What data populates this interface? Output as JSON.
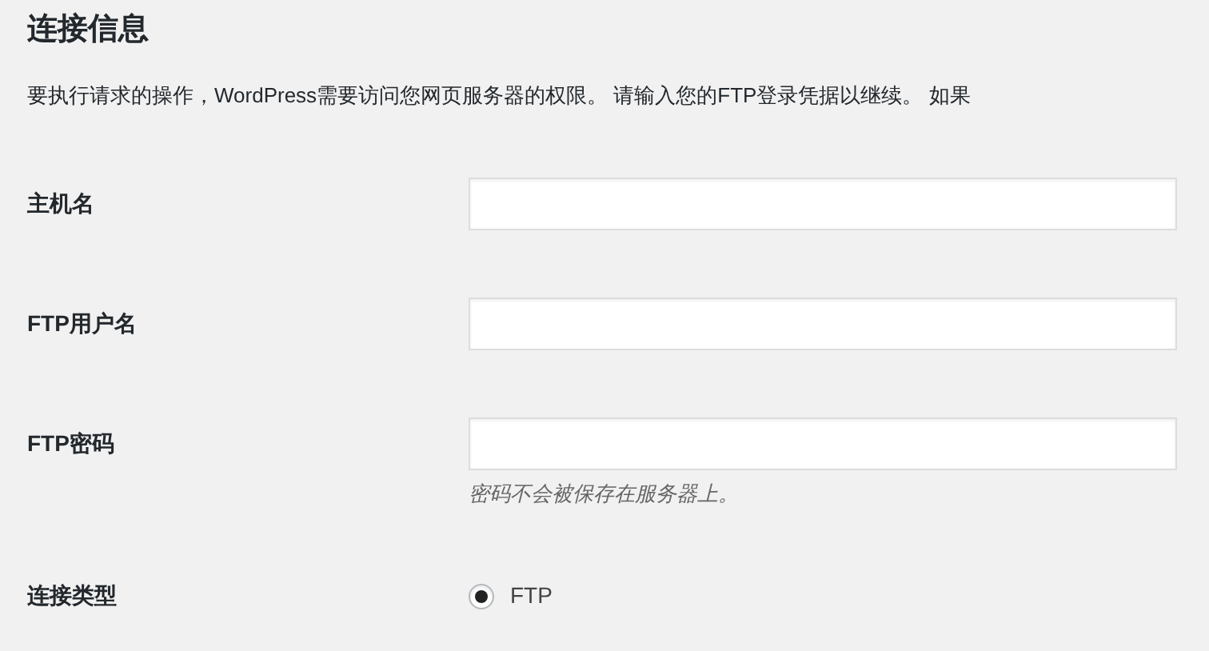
{
  "heading": "连接信息",
  "intro": "要执行请求的操作，WordPress需要访问您网页服务器的权限。 请输入您的FTP登录凭据以继续。 如果",
  "fields": [
    {
      "kind": "text",
      "label": "主机名"
    },
    {
      "kind": "text",
      "label": "FTP用户名"
    },
    {
      "kind": "text",
      "label": "FTP密码",
      "hint": "密码不会被保存在服务器上。"
    },
    {
      "kind": "radio",
      "label": "连接类型",
      "options": [
        {
          "label": "FTP",
          "selected": true
        }
      ]
    }
  ]
}
